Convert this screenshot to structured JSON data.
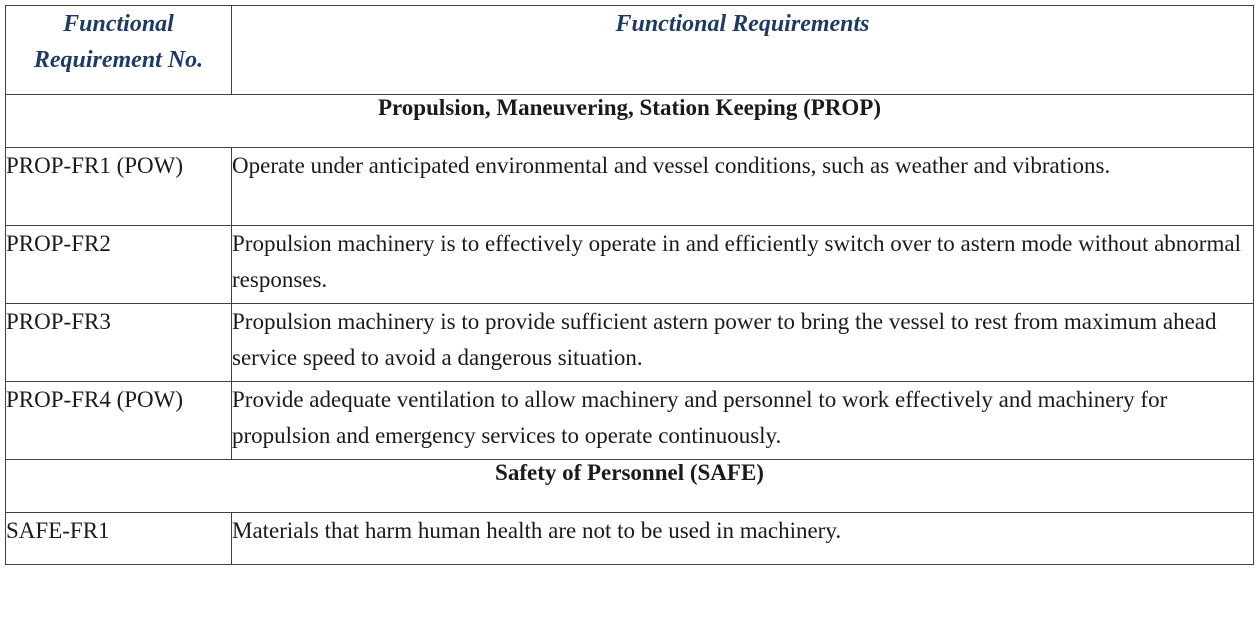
{
  "header": {
    "col1": "Functional Requirement No.",
    "col2": "Functional Requirements"
  },
  "sections": [
    {
      "title": "Propulsion, Maneuvering, Station Keeping (PROP)",
      "rows": [
        {
          "id": "PROP-FR1 (POW)",
          "text": "Operate under anticipated environmental and vessel conditions, such as weather and vibrations."
        },
        {
          "id": "PROP-FR2",
          "text": "Propulsion machinery is to effectively operate in and efficiently switch over to astern mode without abnormal responses."
        },
        {
          "id": "PROP-FR3",
          "text": "Propulsion machinery is to provide sufficient astern power to bring the vessel to rest from maximum ahead service speed to avoid a dangerous situation."
        },
        {
          "id": "PROP-FR4 (POW)",
          "text": "Provide adequate ventilation to allow machinery and personnel to work effectively and machinery for propulsion and emergency services to operate continuously."
        }
      ]
    },
    {
      "title": "Safety of Personnel (SAFE)",
      "rows": [
        {
          "id": "SAFE-FR1",
          "text": "Materials that harm human health are not to be used in machinery."
        }
      ]
    }
  ],
  "colors": {
    "header_text": "#1f3a63",
    "border": "#404040",
    "body_text": "#1a1a1a"
  }
}
